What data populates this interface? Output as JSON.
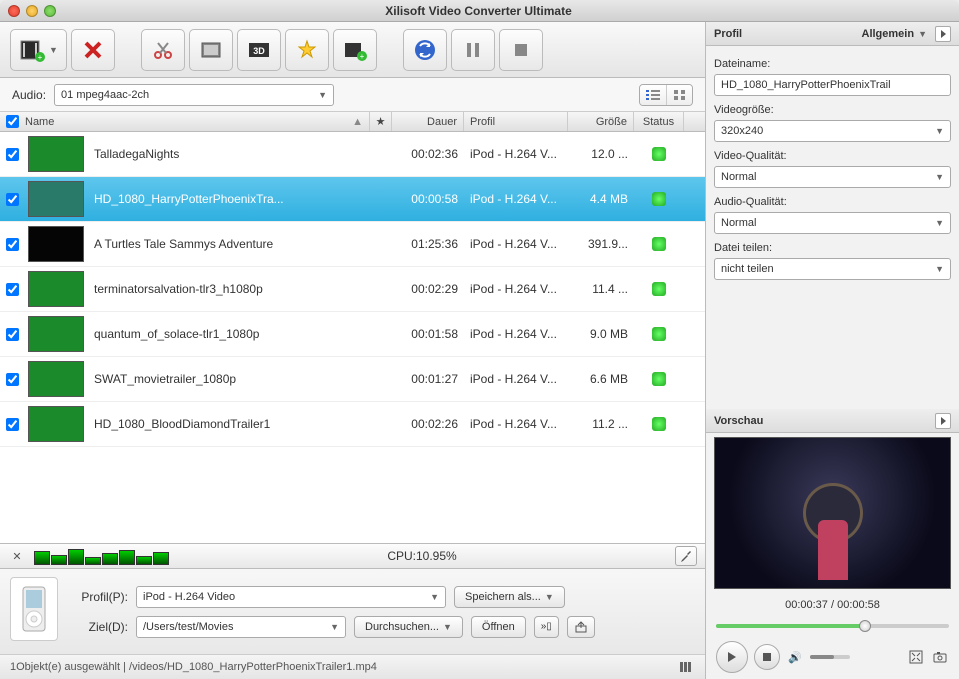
{
  "window": {
    "title": "Xilisoft Video Converter Ultimate"
  },
  "audio": {
    "label": "Audio:",
    "value": "01 mpeg4aac-2ch"
  },
  "columns": {
    "name": "Name",
    "duration": "Dauer",
    "profile": "Profil",
    "size": "Größe",
    "status": "Status"
  },
  "rows": [
    {
      "checked": true,
      "name": "TalladegaNights",
      "dur": "00:02:36",
      "profile": "iPod - H.264 V...",
      "size": "12.0 ...",
      "thumb": "#1a8a2a"
    },
    {
      "checked": true,
      "name": "HD_1080_HarryPotterPhoenixTra...",
      "dur": "00:00:58",
      "profile": "iPod - H.264 V...",
      "size": "4.4 MB",
      "thumb": "#2a7a6a",
      "selected": true
    },
    {
      "checked": true,
      "name": "A Turtles Tale Sammys Adventure",
      "dur": "01:25:36",
      "profile": "iPod - H.264 V...",
      "size": "391.9...",
      "thumb": "#050505"
    },
    {
      "checked": true,
      "name": "terminatorsalvation-tlr3_h1080p",
      "dur": "00:02:29",
      "profile": "iPod - H.264 V...",
      "size": "11.4 ...",
      "thumb": "#1a8a2a"
    },
    {
      "checked": true,
      "name": "quantum_of_solace-tlr1_1080p",
      "dur": "00:01:58",
      "profile": "iPod - H.264 V...",
      "size": "9.0 MB",
      "thumb": "#1a8a2a"
    },
    {
      "checked": true,
      "name": "SWAT_movietrailer_1080p",
      "dur": "00:01:27",
      "profile": "iPod - H.264 V...",
      "size": "6.6 MB",
      "thumb": "#1a8a2a"
    },
    {
      "checked": true,
      "name": "HD_1080_BloodDiamondTrailer1",
      "dur": "00:02:26",
      "profile": "iPod - H.264 V...",
      "size": "11.2 ...",
      "thumb": "#1a8a2a"
    }
  ],
  "cpu": {
    "label": "CPU:10.95%"
  },
  "bottom": {
    "profile_label": "Profil(P):",
    "profile_value": "iPod - H.264 Video",
    "save_as": "Speichern als...",
    "dest_label": "Ziel(D):",
    "dest_value": "/Users/test/Movies",
    "browse": "Durchsuchen...",
    "open": "Öffnen"
  },
  "statusbar": {
    "text": "1Objekt(e) ausgewählt | /videos/HD_1080_HarryPotterPhoenixTrailer1.mp4"
  },
  "profil_panel": {
    "header": "Profil",
    "general": "Allgemein",
    "filename_label": "Dateiname:",
    "filename_value": "HD_1080_HarryPotterPhoenixTrail",
    "videosize_label": "Videogröße:",
    "videosize_value": "320x240",
    "vquality_label": "Video-Qualität:",
    "vquality_value": "Normal",
    "aquality_label": "Audio-Qualität:",
    "aquality_value": "Normal",
    "split_label": "Datei teilen:",
    "split_value": "nicht teilen"
  },
  "preview": {
    "header": "Vorschau",
    "time": "00:00:37 / 00:00:58",
    "progress_pct": 64
  }
}
